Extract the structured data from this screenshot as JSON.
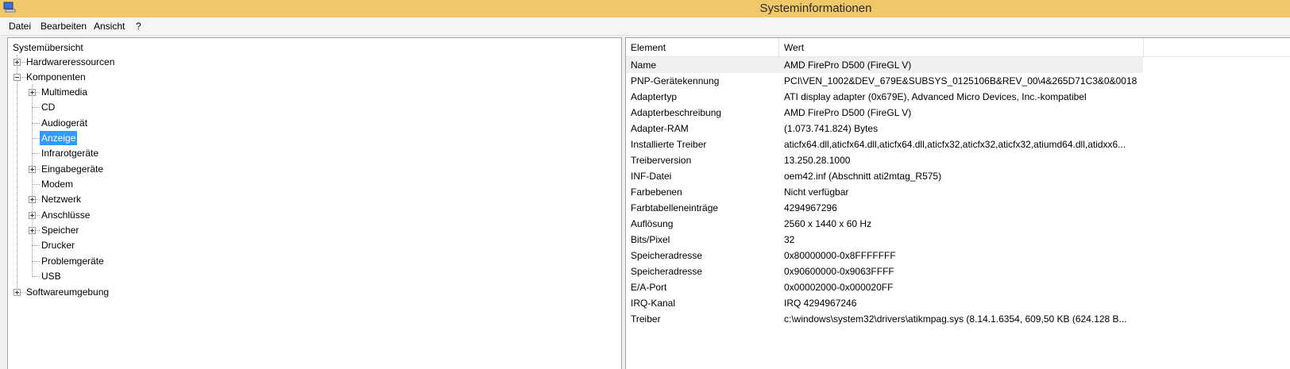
{
  "window": {
    "title": "Systeminformationen"
  },
  "menu": [
    "Datei",
    "Bearbeiten",
    "Ansicht",
    "?"
  ],
  "tree": {
    "root": "Systemübersicht",
    "hardware": "Hardwareressourcen",
    "components": "Komponenten",
    "children": [
      "Multimedia",
      "CD",
      "Audiogerät",
      "Anzeige",
      "Infrarotgeräte",
      "Eingabegeräte",
      "Modem",
      "Netzwerk",
      "Anschlüsse",
      "Speicher",
      "Drucker",
      "Problemgeräte",
      "USB"
    ],
    "software": "Softwareumgebung"
  },
  "table": {
    "headers": [
      "Element",
      "Wert"
    ],
    "rows": [
      [
        "Name",
        "AMD FirePro D500 (FireGL V)"
      ],
      [
        "PNP-Gerätekennung",
        "PCI\\VEN_1002&DEV_679E&SUBSYS_0125106B&REV_00\\4&265D71C3&0&0018"
      ],
      [
        "Adaptertyp",
        "ATI display adapter (0x679E), Advanced Micro Devices, Inc.-kompatibel"
      ],
      [
        "Adapterbeschreibung",
        "AMD FirePro D500 (FireGL V)"
      ],
      [
        "Adapter-RAM",
        "(1.073.741.824) Bytes"
      ],
      [
        "Installierte Treiber",
        "aticfx64.dll,aticfx64.dll,aticfx64.dll,aticfx32,aticfx32,aticfx32,atiumd64.dll,atidxx6..."
      ],
      [
        "Treiberversion",
        "13.250.28.1000"
      ],
      [
        "INF-Datei",
        "oem42.inf (Abschnitt ati2mtag_R575)"
      ],
      [
        "Farbebenen",
        "Nicht verfügbar"
      ],
      [
        "Farbtabelleneinträge",
        "4294967296"
      ],
      [
        "Auflösung",
        "2560 x 1440 x 60 Hz"
      ],
      [
        "Bits/Pixel",
        "32"
      ],
      [
        "Speicheradresse",
        "0x80000000-0x8FFFFFFF"
      ],
      [
        "Speicheradresse",
        "0x90600000-0x9063FFFF"
      ],
      [
        "E/A-Port",
        "0x00002000-0x000020FF"
      ],
      [
        "IRQ-Kanal",
        "IRQ 4294967246"
      ],
      [
        "Treiber",
        "c:\\windows\\system32\\drivers\\atikmpag.sys (8.14.1.6354, 609,50 KB (624.128 B..."
      ]
    ]
  }
}
